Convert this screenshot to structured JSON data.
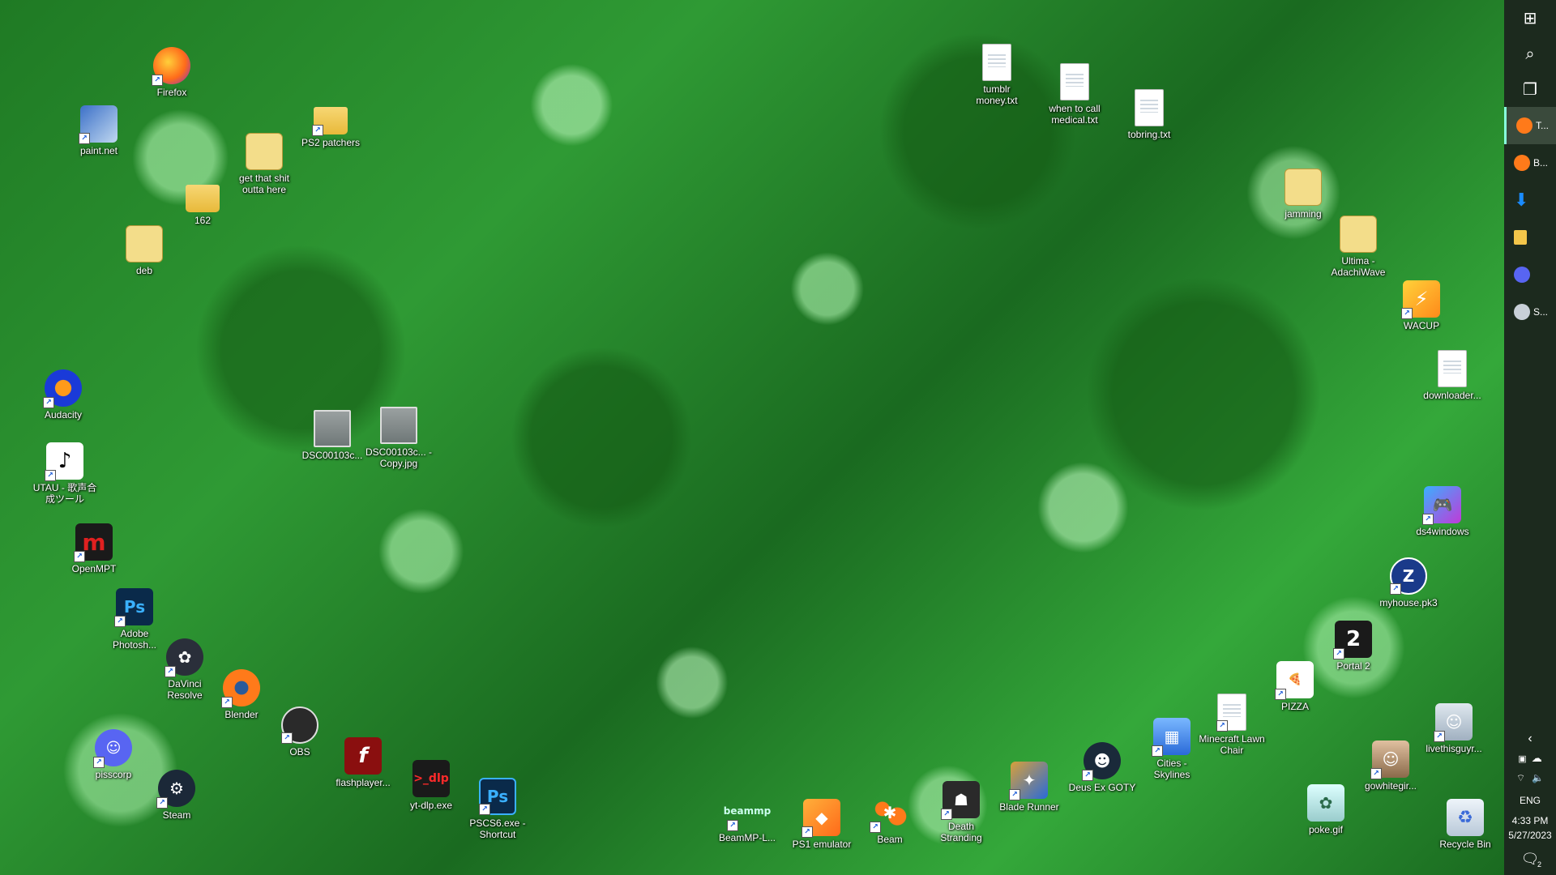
{
  "desktop_icons": [
    {
      "name": "firefox-icon",
      "label": "Firefox"
    },
    {
      "name": "paintnet-icon",
      "label": "paint.net"
    },
    {
      "name": "ps2-patchers-folder-icon",
      "label": "PS2 patchers"
    },
    {
      "name": "get-that-shit-icon",
      "label": "get that shit outta here"
    },
    {
      "name": "folder-162-icon",
      "label": "162"
    },
    {
      "name": "deb-icon",
      "label": "deb"
    },
    {
      "name": "audacity-icon",
      "label": "Audacity"
    },
    {
      "name": "utau-icon",
      "label": "UTAU - 歌声合成ツール"
    },
    {
      "name": "openmpt-icon",
      "label": "OpenMPT"
    },
    {
      "name": "photoshop-icon",
      "label": "Adobe Photosh..."
    },
    {
      "name": "davinci-resolve-icon",
      "label": "DaVinci Resolve"
    },
    {
      "name": "blender-icon",
      "label": "Blender"
    },
    {
      "name": "obs-icon",
      "label": "OBS"
    },
    {
      "name": "pisscorp-icon",
      "label": "pisscorp"
    },
    {
      "name": "steam-icon",
      "label": "Steam"
    },
    {
      "name": "flashplayer-icon",
      "label": "flashplayer..."
    },
    {
      "name": "yt-dlp-icon",
      "label": "yt-dlp.exe"
    },
    {
      "name": "pscs6-icon",
      "label": "PSCS6.exe - Shortcut"
    },
    {
      "name": "dsc-photo-1-icon",
      "label": "DSC00103c..."
    },
    {
      "name": "dsc-photo-2-icon",
      "label": "DSC00103c... - Copy.jpg"
    },
    {
      "name": "tumblr-money-icon",
      "label": "tumblr money.txt"
    },
    {
      "name": "medical-icon",
      "label": "when to call medical.txt"
    },
    {
      "name": "tobring-icon",
      "label": "tobring.txt"
    },
    {
      "name": "jamming-icon",
      "label": "jamming"
    },
    {
      "name": "ultima-icon",
      "label": "Ultima - AdachiWave"
    },
    {
      "name": "wacup-icon",
      "label": "WACUP"
    },
    {
      "name": "downloader-icon",
      "label": "downloader..."
    },
    {
      "name": "ds4windows-icon",
      "label": "ds4windows"
    },
    {
      "name": "myhouse-icon",
      "label": "myhouse.pk3"
    },
    {
      "name": "portal2-icon",
      "label": "Portal 2"
    },
    {
      "name": "pizza-icon",
      "label": "PIZZA"
    },
    {
      "name": "minecraft-chair-icon",
      "label": "Minecraft Lawn Chair"
    },
    {
      "name": "cities-skylines-icon",
      "label": "Cities - Skylines"
    },
    {
      "name": "deus-ex-icon",
      "label": "Deus Ex GOTY"
    },
    {
      "name": "blade-runner-icon",
      "label": "Blade Runner"
    },
    {
      "name": "death-stranding-icon",
      "label": "Death Stranding"
    },
    {
      "name": "beam-icon",
      "label": "Beam"
    },
    {
      "name": "ps1-emulator-icon",
      "label": "PS1 emulator"
    },
    {
      "name": "beammp-icon",
      "label": "BeamMP-L..."
    },
    {
      "name": "livethisguy-icon",
      "label": "livethisguyr..."
    },
    {
      "name": "gowhitegir-icon",
      "label": "gowhitegir..."
    },
    {
      "name": "poke-gif-icon",
      "label": "poke.gif"
    },
    {
      "name": "recycle-bin-icon",
      "label": "Recycle Bin"
    }
  ],
  "taskbar": {
    "start_glyph": "⊞",
    "search_glyph": "⌕",
    "taskview_glyph": "❐",
    "apps": [
      {
        "label": "T...",
        "color": "#ff7a1a"
      },
      {
        "label": "B...",
        "color": "#ff7a1a"
      },
      {
        "label": "",
        "color": "#1a8cff"
      },
      {
        "label": "",
        "color": "#f3c64a"
      },
      {
        "label": "",
        "color": "#5865f2"
      },
      {
        "label": "S...",
        "color": "#d0d8e0"
      }
    ]
  },
  "tray": {
    "chevron": "‹",
    "language": "ENG",
    "time": "4:33 PM",
    "date": "5/27/2023",
    "notifications": "2"
  }
}
